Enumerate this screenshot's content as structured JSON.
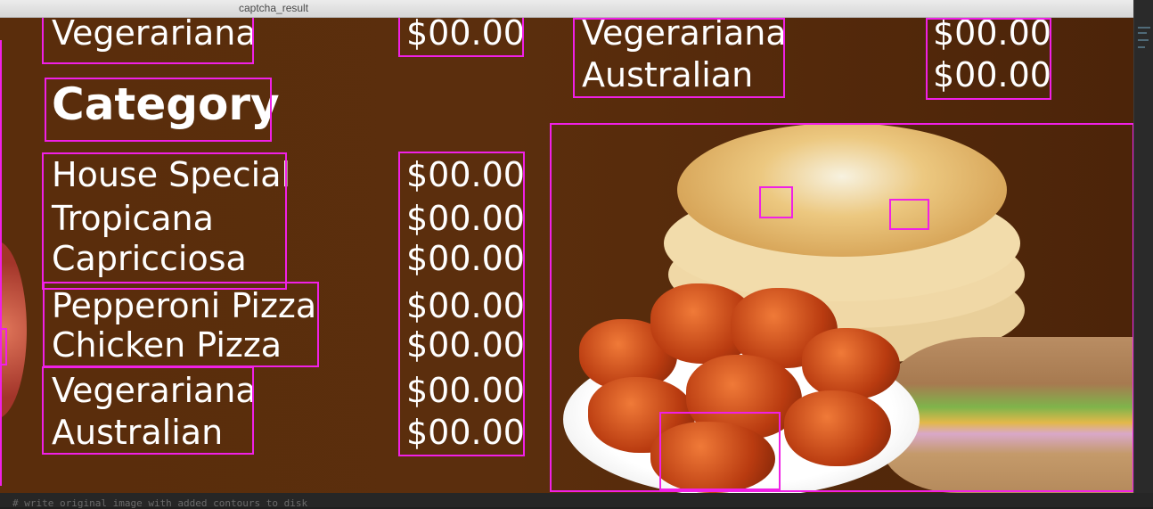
{
  "window": {
    "title": "captcha_result"
  },
  "menu": {
    "left_top": {
      "name": "Vegerariana",
      "price": "$00.00"
    },
    "right_top": [
      {
        "name": "Vegerariana",
        "price": "$00.00"
      },
      {
        "name": "Australian",
        "price": "$00.00"
      }
    ],
    "category_title": "Category",
    "items": [
      {
        "name": "House Special",
        "price": "$00.00"
      },
      {
        "name": "Tropicana",
        "price": "$00.00"
      },
      {
        "name": "Capricciosa",
        "price": "$00.00"
      },
      {
        "name": "Pepperoni Pizza",
        "price": "$00.00"
      },
      {
        "name": "Chicken Pizza",
        "price": "$00.00"
      },
      {
        "name": "Vegerariana",
        "price": "$00.00"
      },
      {
        "name": "Australian",
        "price": "$00.00"
      }
    ]
  },
  "overlay": {
    "contour_color": "#f020e6"
  },
  "editor": {
    "code_line": "# write original image with added contours to disk"
  },
  "food_image": {
    "icon": "pancakes-wings-sandwich-photo"
  }
}
